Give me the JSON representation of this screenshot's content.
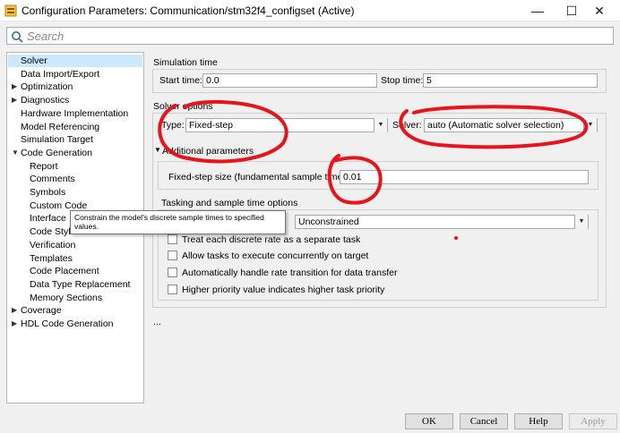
{
  "window": {
    "title": "Configuration Parameters: Communication/stm32f4_configset (Active)",
    "minimize": "—",
    "maximize": "☐",
    "close": "✕"
  },
  "search": {
    "placeholder": "Search",
    "value": ""
  },
  "tree": {
    "items": [
      {
        "label": "Solver",
        "selected": true,
        "expander": ""
      },
      {
        "label": "Data Import/Export",
        "expander": ""
      },
      {
        "label": "Optimization",
        "expander": "▶"
      },
      {
        "label": "Diagnostics",
        "expander": "▶"
      },
      {
        "label": "Hardware Implementation",
        "expander": ""
      },
      {
        "label": "Model Referencing",
        "expander": ""
      },
      {
        "label": "Simulation Target",
        "expander": ""
      },
      {
        "label": "Code Generation",
        "expander": "▼"
      },
      {
        "label": "Report",
        "expander": ""
      },
      {
        "label": "Comments",
        "expander": ""
      },
      {
        "label": "Symbols",
        "expander": ""
      },
      {
        "label": "Custom Code",
        "expander": ""
      },
      {
        "label": "Interface",
        "expander": ""
      },
      {
        "label": "Code Style",
        "expander": ""
      },
      {
        "label": "Verification",
        "expander": ""
      },
      {
        "label": "Templates",
        "expander": ""
      },
      {
        "label": "Code Placement",
        "expander": ""
      },
      {
        "label": "Data Type Replacement",
        "expander": ""
      },
      {
        "label": "Memory Sections",
        "expander": ""
      },
      {
        "label": "Coverage",
        "expander": "▶"
      },
      {
        "label": "HDL Code Generation",
        "expander": "▶"
      }
    ]
  },
  "simulation_time": {
    "heading": "Simulation time",
    "start_label": "Start time:",
    "start_value": "0.0",
    "stop_label": "Stop time:",
    "stop_value": "5"
  },
  "solver_options": {
    "heading": "Solver options",
    "type_label": "Type:",
    "type_value": "Fixed-step",
    "solver_label": "Solver:",
    "solver_value": "auto (Automatic solver selection)",
    "dropdown_arrow": "▼"
  },
  "additional": {
    "expander": "▼",
    "heading": "Additional parameters",
    "step_label": "Fixed-step size (fundamental sample time):",
    "step_value": "0.01",
    "tasking_heading": "Tasking and sample time options",
    "periodic_value": "Unconstrained",
    "checkboxes": [
      "Treat each discrete rate as a separate task",
      "Allow tasks to execute concurrently on target",
      "Automatically handle rate transition for data transfer",
      "Higher priority value indicates higher task priority"
    ]
  },
  "more": "...",
  "tooltip": {
    "line1": "Constrain the model's discrete sample times to specified",
    "line2": "values."
  },
  "buttons": {
    "ok": "OK",
    "cancel": "Cancel",
    "help": "Help",
    "apply": "Apply"
  },
  "colors": {
    "selection": "#cce8ff",
    "annotation": "#e8131b"
  }
}
